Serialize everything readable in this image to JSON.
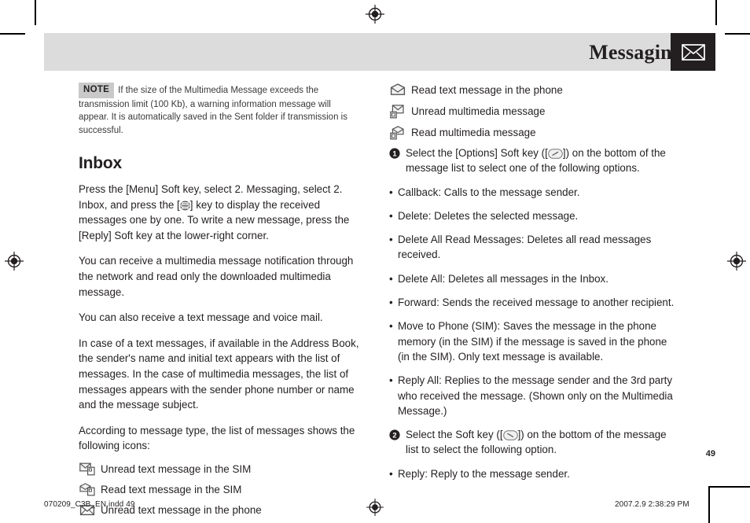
{
  "header": {
    "title": "Messaging",
    "icon": "envelope-icon"
  },
  "note": {
    "badge": "NOTE",
    "text": "If the size of the Multimedia Message exceeds the transmission limit (100 Kb), a warning information message will appear. It is automatically saved in the Sent folder if transmission is successful."
  },
  "left_column": {
    "section_title": "Inbox",
    "paragraphs": [
      {
        "before": "Press the [Menu] Soft key, select 2. Messaging, select 2. Inbox, and press the [",
        "icon": "ok-key-globe-icon",
        "after": "] key to display the received messages one by one. To write a new message, press the [Reply] Soft key at the lower-right corner."
      },
      {
        "text": "You can receive a multimedia message notification through the network and read only the downloaded multimedia message."
      },
      {
        "text": "You can also receive a text message and voice mail."
      },
      {
        "text": "In case of a text messages, if available in the Address Book, the sender's name and initial text appears with the list of messages. In the case of multimedia messages, the list of messages appears with the sender phone number or name and the message subject."
      },
      {
        "text": "According to message type, the list of messages shows the following icons:"
      }
    ],
    "icon_list": [
      {
        "icon": "unread-text-sim-icon",
        "label": "Unread text message in the SIM"
      },
      {
        "icon": "read-text-sim-icon",
        "label": "Read text message in the SIM"
      },
      {
        "icon": "unread-text-phone-icon",
        "label": "Unread text message in the phone"
      }
    ]
  },
  "right_column": {
    "icon_list": [
      {
        "icon": "read-text-phone-icon",
        "label": "Read text message in the phone"
      },
      {
        "icon": "unread-multimedia-icon",
        "label": "Unread multimedia message"
      },
      {
        "icon": "read-multimedia-icon",
        "label": "Read multimedia message"
      }
    ],
    "step_one": {
      "number": "1",
      "before": "Select the [Options] Soft key ([",
      "icon": "left-softkey-icon",
      "after": "]) on the bottom of the message list to select one of the following options."
    },
    "options_one": [
      "Callback: Calls to the message sender.",
      "Delete: Deletes the selected message.",
      "Delete All Read Messages: Deletes all read messages received.",
      "Delete All: Deletes all messages in the Inbox.",
      "Forward: Sends the received message to another recipient.",
      "Move to Phone (SIM): Saves the message in the phone memory (in the SIM) if the message is saved in the phone (in the SIM). Only text message is available.",
      "Reply All: Replies to the message sender and the 3rd party who received the message. (Shown only on the Multimedia Message.)"
    ],
    "step_two": {
      "number": "2",
      "before": "Select the Soft key ([",
      "icon": "right-softkey-icon",
      "after": "]) on the bottom of the message list to select the following option."
    },
    "options_two": [
      "Reply: Reply to the message sender."
    ]
  },
  "page_number": "49",
  "footer": {
    "left": "070209_C3B_EN.indd   49",
    "right": "2007.2.9   2:38:29 PM",
    "registration_icon": "registration-target-icon"
  },
  "bullet_char": "•",
  "colors": {
    "header_bar": "#dcdcdc",
    "header_icon_box": "#231f20",
    "note_badge": "#c9c9c9",
    "text": "#231f20"
  }
}
